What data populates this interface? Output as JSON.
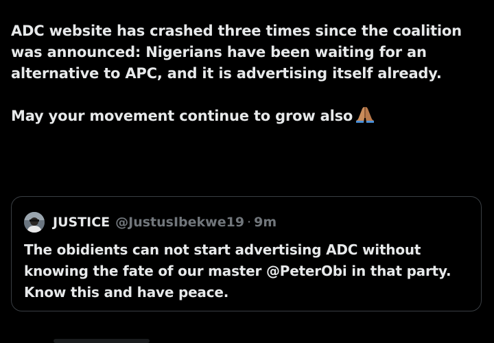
{
  "post": {
    "line1": "ADC website has crashed three times since the coalition was announced: Nigerians have been waiting for an alternative to APC, and it is advertising itself already.",
    "line2": "May your movement continue to grow also",
    "emoji": "folded-hands-emoji"
  },
  "quoted_post": {
    "name": "JUSTICE",
    "handle": "@JustusIbekwe19",
    "separator": "·",
    "time": "9m",
    "text": "The obidients can not start advertising ADC without knowing the fate of our master @PeterObi in that party. Know this and have peace."
  },
  "colors": {
    "background": "#000000",
    "text_primary": "#e7e9ea",
    "text_secondary": "#71767b",
    "card_border": "#3a3f44"
  }
}
